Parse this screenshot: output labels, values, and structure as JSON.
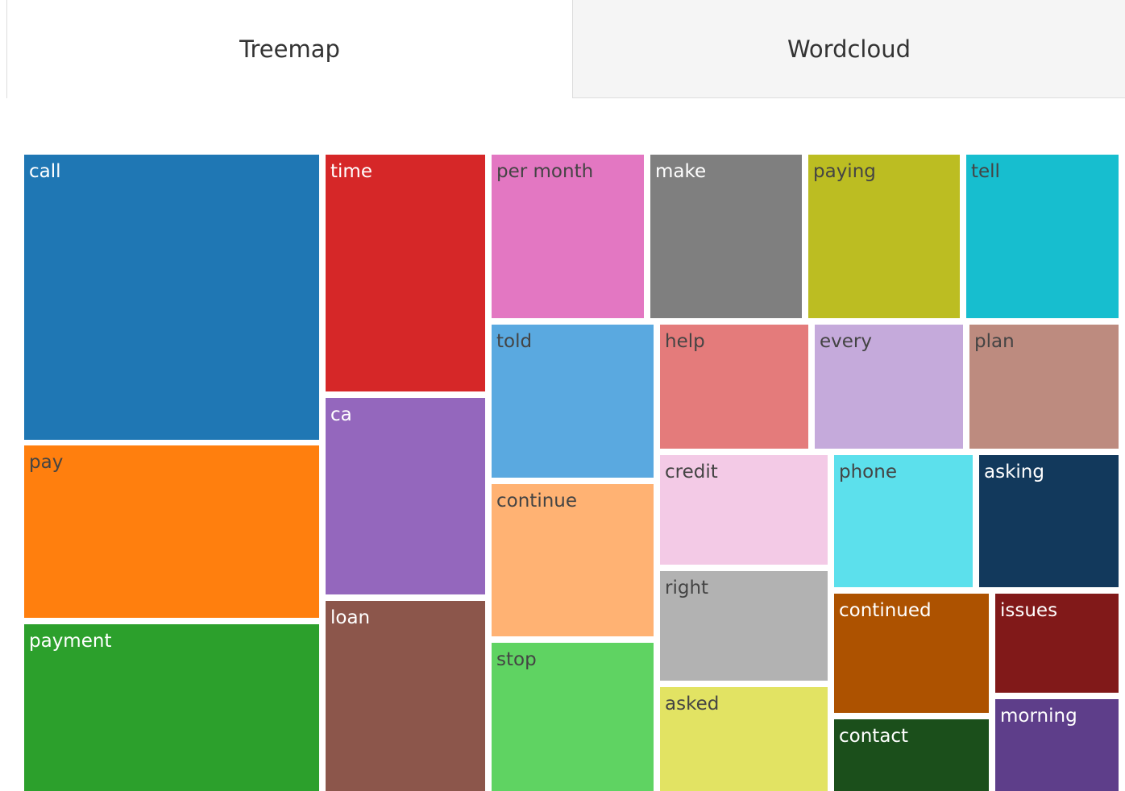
{
  "tabs": [
    {
      "label": "Treemap",
      "active": true
    },
    {
      "label": "Wordcloud",
      "active": false
    }
  ],
  "chart_data": {
    "type": "treemap",
    "items": [
      {
        "label": "call",
        "color": "#1f77b4",
        "text_color": "#ffffff"
      },
      {
        "label": "pay",
        "color": "#ff7f0e",
        "text_color": "#444444"
      },
      {
        "label": "payment",
        "color": "#2ca02c",
        "text_color": "#ffffff"
      },
      {
        "label": "time",
        "color": "#d62728",
        "text_color": "#ffffff"
      },
      {
        "label": "ca",
        "color": "#9467bd",
        "text_color": "#ffffff"
      },
      {
        "label": "loan",
        "color": "#8c564b",
        "text_color": "#ffffff"
      },
      {
        "label": "per month",
        "color": "#e377c2",
        "text_color": "#444444"
      },
      {
        "label": "make",
        "color": "#7f7f7f",
        "text_color": "#ffffff"
      },
      {
        "label": "paying",
        "color": "#bcbd22",
        "text_color": "#444444"
      },
      {
        "label": "tell",
        "color": "#17becf",
        "text_color": "#444444"
      },
      {
        "label": "told",
        "color": "#5aa9e0",
        "text_color": "#444444"
      },
      {
        "label": "continue",
        "color": "#ffb273",
        "text_color": "#444444"
      },
      {
        "label": "stop",
        "color": "#5fd362",
        "text_color": "#444444"
      },
      {
        "label": "help",
        "color": "#e47b7b",
        "text_color": "#444444"
      },
      {
        "label": "every",
        "color": "#c5aadb",
        "text_color": "#444444"
      },
      {
        "label": "plan",
        "color": "#bd8b7f",
        "text_color": "#444444"
      },
      {
        "label": "credit",
        "color": "#f3cae6",
        "text_color": "#444444"
      },
      {
        "label": "right",
        "color": "#b2b2b2",
        "text_color": "#444444"
      },
      {
        "label": "asked",
        "color": "#e2e363",
        "text_color": "#444444"
      },
      {
        "label": "phone",
        "color": "#5ce0ec",
        "text_color": "#444444"
      },
      {
        "label": "asking",
        "color": "#12395c",
        "text_color": "#ffffff"
      },
      {
        "label": "continued",
        "color": "#ad5200",
        "text_color": "#ffffff"
      },
      {
        "label": "issues",
        "color": "#811919",
        "text_color": "#ffffff"
      },
      {
        "label": "contact",
        "color": "#1b4f1b",
        "text_color": "#ffffff"
      },
      {
        "label": "morning",
        "color": "#5e3e8a",
        "text_color": "#ffffff"
      }
    ]
  }
}
